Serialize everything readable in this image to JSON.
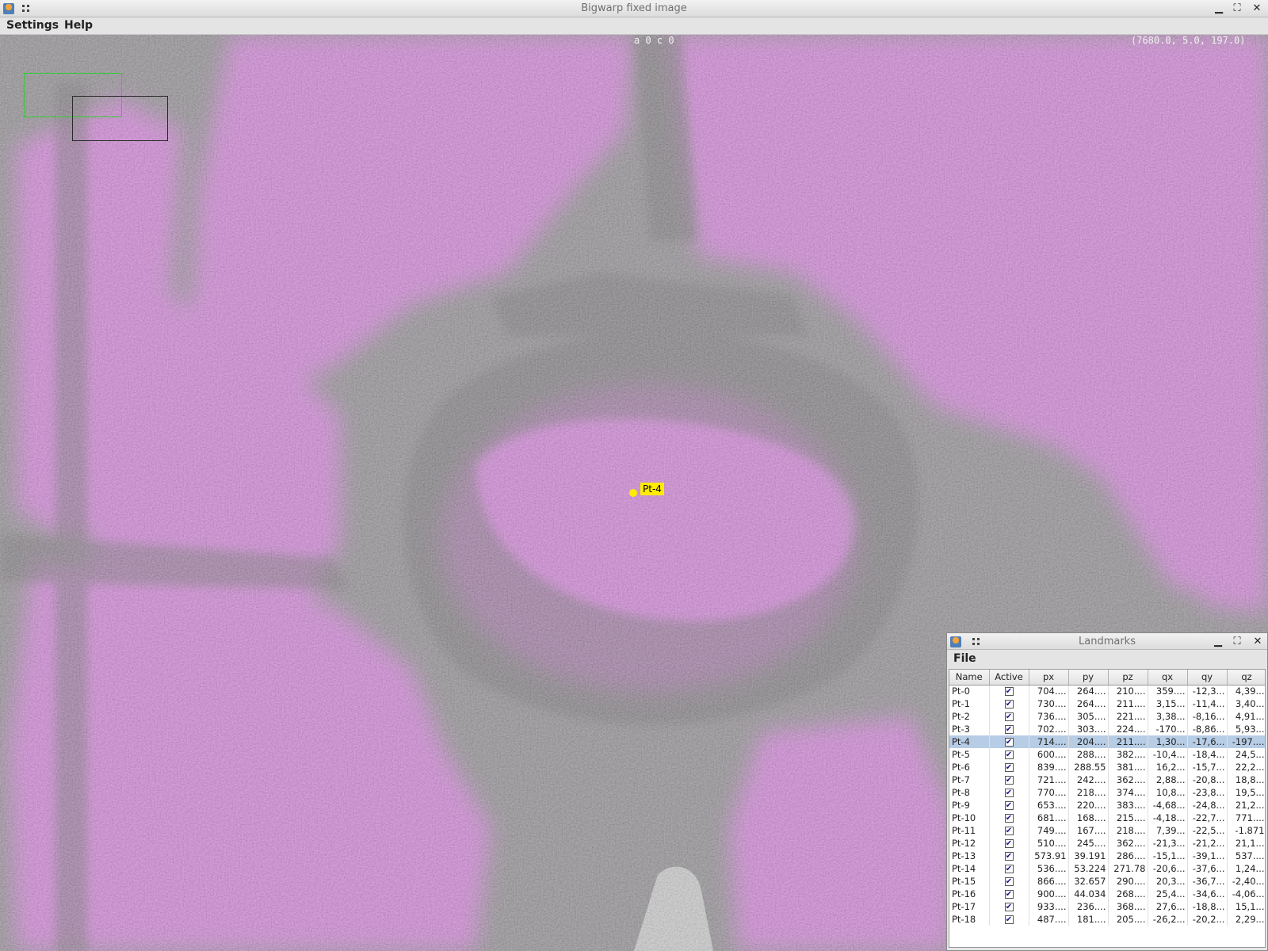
{
  "window": {
    "title": "Bigwarp fixed image"
  },
  "menu": {
    "settings": "Settings",
    "help": "Help"
  },
  "viewer": {
    "info_text": "a 0 c 0",
    "coords_text": "(7680.0,    5.0,  197.0)",
    "landmark_label": "Pt-4"
  },
  "landmarks_window": {
    "title": "Landmarks",
    "menu_file": "File",
    "columns": [
      "Name",
      "Active",
      "px",
      "py",
      "pz",
      "qx",
      "qy",
      "qz"
    ],
    "rows": [
      {
        "name": "Pt-0",
        "active": true,
        "px": "704....",
        "py": "264....",
        "pz": "210....",
        "qx": "359....",
        "qy": "-12,3...",
        "qz": "4,39..."
      },
      {
        "name": "Pt-1",
        "active": true,
        "px": "730....",
        "py": "264....",
        "pz": "211....",
        "qx": "3,15...",
        "qy": "-11,4...",
        "qz": "3,40..."
      },
      {
        "name": "Pt-2",
        "active": true,
        "px": "736....",
        "py": "305....",
        "pz": "221....",
        "qx": "3,38...",
        "qy": "-8,16...",
        "qz": "4,91..."
      },
      {
        "name": "Pt-3",
        "active": true,
        "px": "702....",
        "py": "303....",
        "pz": "224....",
        "qx": "-170...",
        "qy": "-8,86...",
        "qz": "5,93..."
      },
      {
        "name": "Pt-4",
        "active": true,
        "px": "714....",
        "py": "204....",
        "pz": "211....",
        "qx": "1,30...",
        "qy": "-17,6...",
        "qz": "-197...."
      },
      {
        "name": "Pt-5",
        "active": true,
        "px": "600....",
        "py": "288....",
        "pz": "382....",
        "qx": "-10,4...",
        "qy": "-18,4...",
        "qz": "24,5..."
      },
      {
        "name": "Pt-6",
        "active": true,
        "px": "839....",
        "py": "288.55",
        "pz": "381....",
        "qx": "16,2...",
        "qy": "-15,7...",
        "qz": "22,2..."
      },
      {
        "name": "Pt-7",
        "active": true,
        "px": "721....",
        "py": "242....",
        "pz": "362....",
        "qx": "2,88...",
        "qy": "-20,8...",
        "qz": "18,8..."
      },
      {
        "name": "Pt-8",
        "active": true,
        "px": "770....",
        "py": "218....",
        "pz": "374....",
        "qx": "10,8...",
        "qy": "-23,8...",
        "qz": "19,5..."
      },
      {
        "name": "Pt-9",
        "active": true,
        "px": "653....",
        "py": "220....",
        "pz": "383....",
        "qx": "-4,68...",
        "qy": "-24,8...",
        "qz": "21,2..."
      },
      {
        "name": "Pt-10",
        "active": true,
        "px": "681....",
        "py": "168....",
        "pz": "215....",
        "qx": "-4,18...",
        "qy": "-22,7...",
        "qz": "771...."
      },
      {
        "name": "Pt-11",
        "active": true,
        "px": "749....",
        "py": "167....",
        "pz": "218....",
        "qx": "7,39...",
        "qy": "-22,5...",
        "qz": "-1.871"
      },
      {
        "name": "Pt-12",
        "active": true,
        "px": "510....",
        "py": "245....",
        "pz": "362....",
        "qx": "-21,3...",
        "qy": "-21,2...",
        "qz": "21,1..."
      },
      {
        "name": "Pt-13",
        "active": true,
        "px": "573.91",
        "py": "39.191",
        "pz": "286....",
        "qx": "-15,1...",
        "qy": "-39,1...",
        "qz": "537...."
      },
      {
        "name": "Pt-14",
        "active": true,
        "px": "536....",
        "py": "53.224",
        "pz": "271.78",
        "qx": "-20,6...",
        "qy": "-37,6...",
        "qz": "1,24..."
      },
      {
        "name": "Pt-15",
        "active": true,
        "px": "866....",
        "py": "32.657",
        "pz": "290....",
        "qx": "20,3...",
        "qy": "-36,7...",
        "qz": "-2,40..."
      },
      {
        "name": "Pt-16",
        "active": true,
        "px": "900....",
        "py": "44.034",
        "pz": "268....",
        "qx": "25,4...",
        "qy": "-34,6...",
        "qz": "-4,06..."
      },
      {
        "name": "Pt-17",
        "active": true,
        "px": "933....",
        "py": "236....",
        "pz": "368....",
        "qx": "27,6...",
        "qy": "-18,8...",
        "qz": "15,1..."
      },
      {
        "name": "Pt-18",
        "active": true,
        "px": "487....",
        "py": "181....",
        "pz": "205....",
        "qx": "-26,2...",
        "qy": "-20,2...",
        "qz": "2,29..."
      }
    ],
    "selected_row": "Pt-4"
  },
  "colors": {
    "overlay_magenta": "#e879f0",
    "tissue_gray": "#8c8c8c",
    "landmark_yellow": "#ffec00",
    "selection_blue": "#b7cde5"
  }
}
